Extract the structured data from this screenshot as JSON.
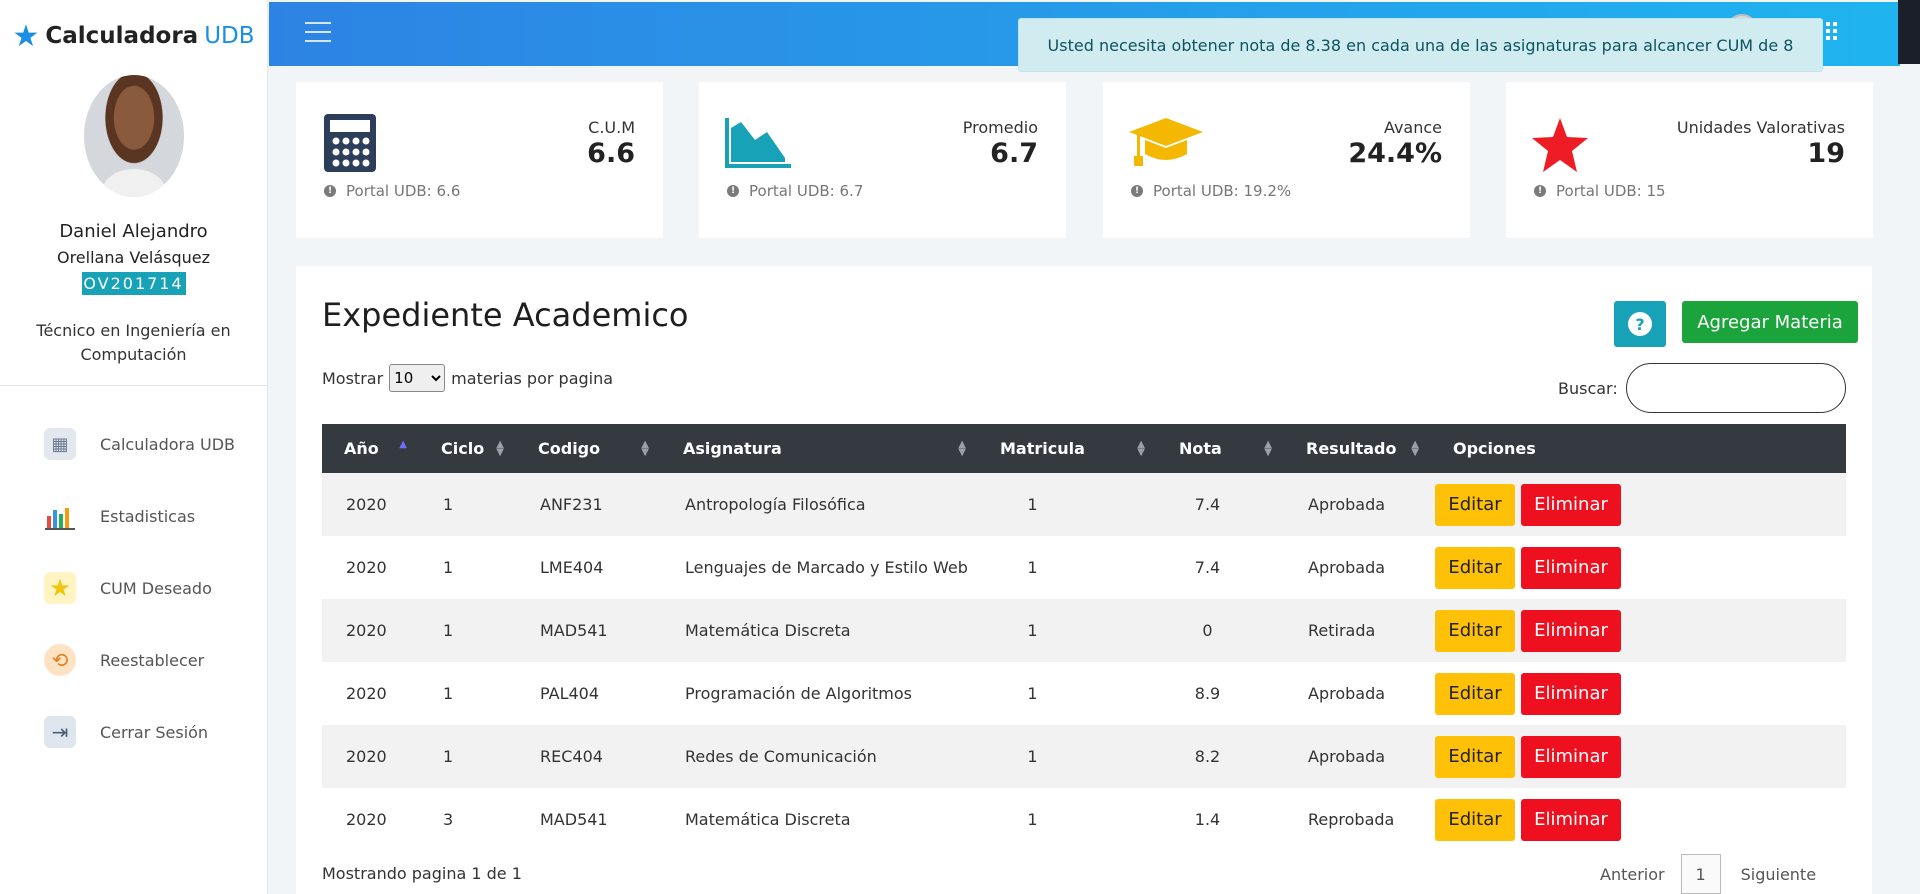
{
  "brand": {
    "name": "Calculadora",
    "accent": "UDB"
  },
  "user": {
    "first_name": "Daniel Alejandro",
    "last_name": "Orellana Velásquez",
    "id": "OV201714",
    "career": "Técnico en Ingeniería en Computación"
  },
  "nav": [
    {
      "label": "Calculadora UDB",
      "icon": "calculator-icon"
    },
    {
      "label": "Estadisticas",
      "icon": "statistics-icon"
    },
    {
      "label": "CUM Deseado",
      "icon": "star-target-icon"
    },
    {
      "label": "Reestablecer",
      "icon": "reset-icon"
    },
    {
      "label": "Cerrar Sesión",
      "icon": "logout-icon"
    }
  ],
  "alert": {
    "message": "Usted necesita obtener nota de 8.38 en cada una de las asignaturas para alcancer CUM de 8"
  },
  "cards": [
    {
      "label": "C.U.M",
      "value": "6.6",
      "footer": "Portal UDB: 6.6",
      "icon": "calculator-icon",
      "color": "#2c3e5a"
    },
    {
      "label": "Promedio",
      "value": "6.7",
      "footer": "Portal UDB: 6.7",
      "icon": "area-chart-icon",
      "color": "#17a2b8"
    },
    {
      "label": "Avance",
      "value": "24.4%",
      "footer": "Portal UDB: 19.2%",
      "icon": "graduation-cap-icon",
      "color": "#f5b800"
    },
    {
      "label": "Unidades Valorativas",
      "value": "19",
      "footer": "Portal UDB: 15",
      "icon": "star-icon",
      "color": "#ee1c25"
    }
  ],
  "panel": {
    "title": "Expediente Academico",
    "add_label": "Agregar Materia",
    "show_prefix": "Mostrar",
    "show_value": "10",
    "show_suffix": "materias por pagina",
    "search_label": "Buscar:",
    "search_value": "",
    "showing_text": "Mostrando pagina 1 de 1",
    "prev_label": "Anterior",
    "page": "1",
    "next_label": "Siguiente"
  },
  "table": {
    "headers": [
      "Año",
      "Ciclo",
      "Codigo",
      "Asignatura",
      "Matricula",
      "Nota",
      "Resultado",
      "Opciones"
    ],
    "edit_label": "Editar",
    "delete_label": "Eliminar",
    "rows": [
      [
        "2020",
        "1",
        "ANF231",
        "Antropología Filosófica",
        "1",
        "7.4",
        "Aprobada"
      ],
      [
        "2020",
        "1",
        "LME404",
        "Lenguajes de Marcado y Estilo Web",
        "1",
        "7.4",
        "Aprobada"
      ],
      [
        "2020",
        "1",
        "MAD541",
        "Matemática Discreta",
        "1",
        "0",
        "Retirada"
      ],
      [
        "2020",
        "1",
        "PAL404",
        "Programación de Algoritmos",
        "1",
        "8.9",
        "Aprobada"
      ],
      [
        "2020",
        "1",
        "REC404",
        "Redes de Comunicación",
        "1",
        "8.2",
        "Aprobada"
      ],
      [
        "2020",
        "3",
        "MAD541",
        "Matemática Discreta",
        "1",
        "1.4",
        "Reprobada"
      ]
    ]
  }
}
